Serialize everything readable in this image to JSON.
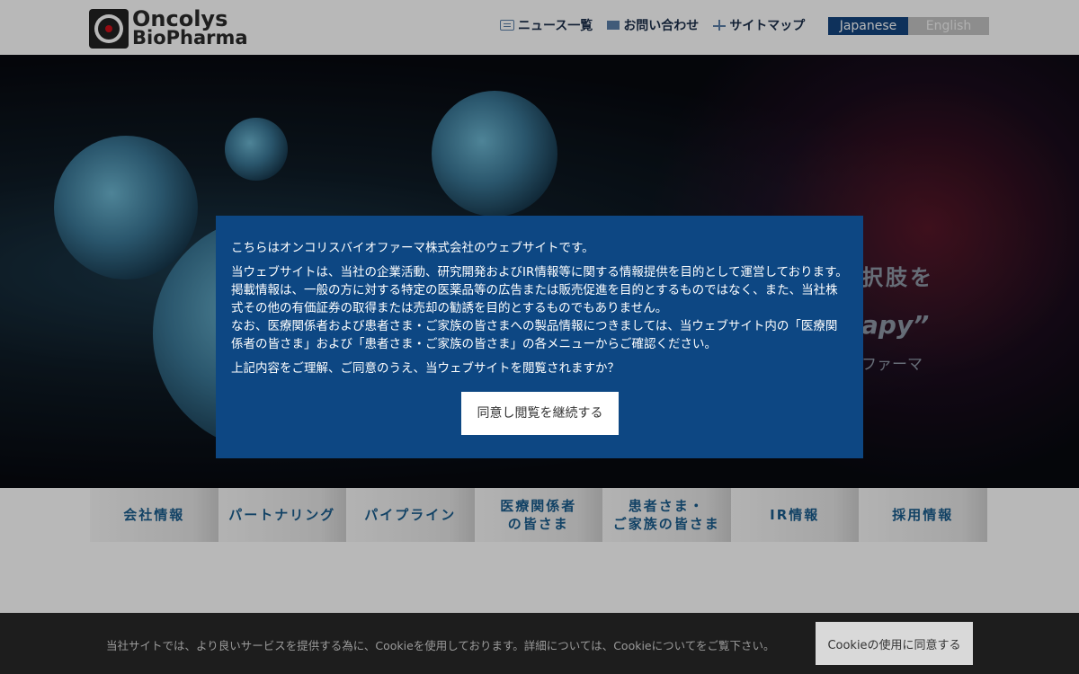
{
  "header": {
    "logo": {
      "line1": "Oncolys",
      "line2": "BioPharma"
    },
    "links": [
      {
        "label": "ニュース一覧",
        "icon": "news-icon"
      },
      {
        "label": "お問い合わせ",
        "icon": "mail-icon"
      },
      {
        "label": "サイトマップ",
        "icon": "sitemap-icon"
      }
    ],
    "lang": {
      "japanese": "Japanese",
      "english": "English"
    }
  },
  "hero": {
    "text1": "択肢を",
    "text2": "apy”",
    "text3": "ファーマ"
  },
  "modal": {
    "p1": "こちらはオンコリスバイオファーマ株式会社のウェブサイトです。",
    "p2": "当ウェブサイトは、当社の企業活動、研究開発およびIR情報等に関する情報提供を目的として運営しております。掲載情報は、一般の方に対する特定の医薬品等の広告または販売促進を目的とするものではなく、また、当社株式その他の有価証券の取得または売却の勧誘を目的とするものでもありません。",
    "p3": "なお、医療関係者および患者さま・ご家族の皆さまへの製品情報につきましては、当ウェブサイト内の「医療関係者の皆さま」および「患者さま・ご家族の皆さま」の各メニューからご確認ください。",
    "p4": "上記内容をご理解、ご同意のうえ、当ウェブサイトを閲覧されますか？",
    "button": "同意し閲覧を継続する"
  },
  "mainnav": [
    {
      "line1": "会社情報",
      "line2": ""
    },
    {
      "line1": "パートナリング",
      "line2": ""
    },
    {
      "line1": "パイプライン",
      "line2": ""
    },
    {
      "line1": "医療関係者",
      "line2": "の皆さま"
    },
    {
      "line1": "患者さま・",
      "line2": "ご家族の皆さま"
    },
    {
      "line1": "IR情報",
      "line2": ""
    },
    {
      "line1": "採用情報",
      "line2": ""
    }
  ],
  "cookie": {
    "message_pre": "当社サイトでは、より良いサービスを提供する為に、Cookieを使用しております。詳細については、",
    "message_link": "Cookieについて",
    "message_post": "をご覧下さい。",
    "button": "Cookieの使用に同意する"
  },
  "colors": {
    "brand_blue": "#0d4783",
    "lang_active": "#14447f",
    "nav_text": "#1a5c8c"
  }
}
